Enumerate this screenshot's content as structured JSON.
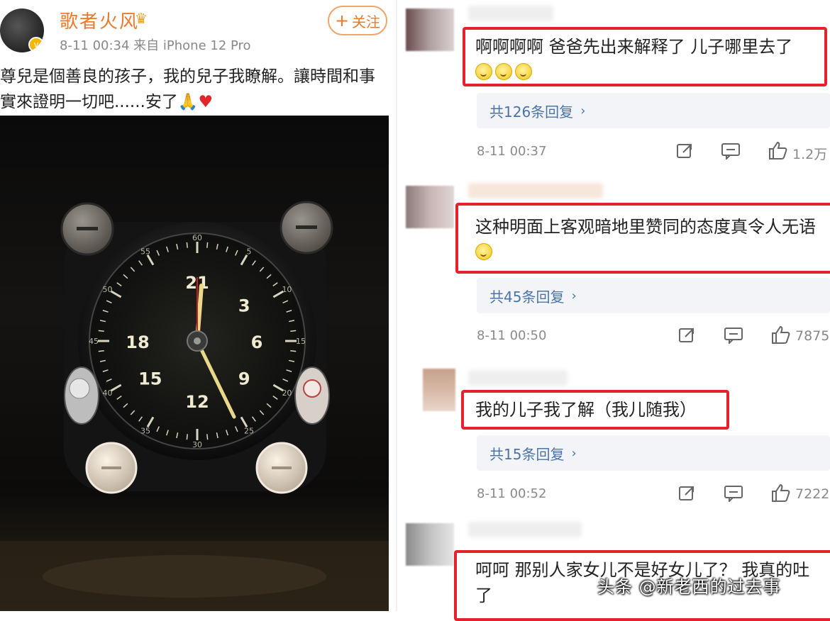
{
  "post": {
    "author": "歌者火风",
    "meta": "8-11 00:34  来自 iPhone 12 Pro",
    "follow_label": "关注",
    "text": "尊兒是個善良的孩子，我的兒子我瞭解。讓時間和事實來證明一切吧......安了"
  },
  "clock": {
    "hour_numbers": [
      "21",
      "3",
      "6",
      "9",
      "12",
      "15",
      "18"
    ],
    "minute_numbers": [
      "60",
      "5",
      "10",
      "15",
      "20",
      "25",
      "30",
      "35",
      "40",
      "45",
      "50",
      "55"
    ]
  },
  "comments": [
    {
      "text": "啊啊啊啊  爸爸先出来解释了 儿子哪里去了",
      "replies": "共126条回复",
      "time": "8-11 00:37",
      "likes": "1.2万"
    },
    {
      "text": "这种明面上客观暗地里赞同的态度真令人无语",
      "replies": "共45条回复",
      "time": "8-11 00:50",
      "likes": "7875"
    },
    {
      "text": "我的儿子我了解（我儿随我）",
      "replies": "共15条回复",
      "time": "8-11 00:52",
      "likes": "7222"
    },
    {
      "text": "呵呵 那别人家女儿不是好女儿了？ 我真的吐了"
    }
  ],
  "watermark": "头条 @新老西的过去事",
  "colors": {
    "accent": "#ea7a2a",
    "highlight": "#e5212c",
    "link": "#4a74a8"
  }
}
